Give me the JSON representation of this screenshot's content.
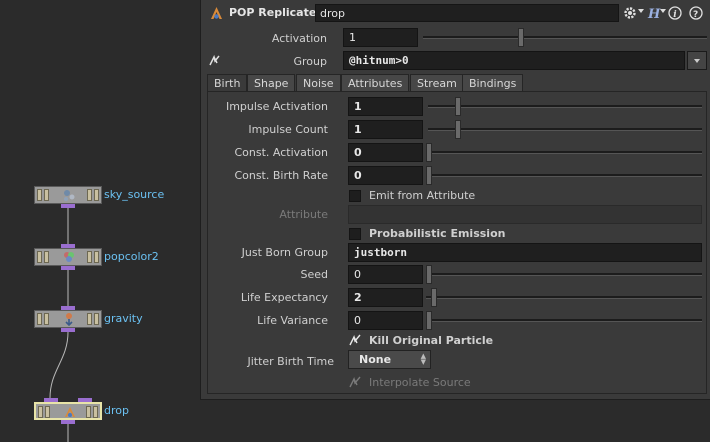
{
  "network": {
    "nodes": [
      {
        "name": "sky_source"
      },
      {
        "name": "popcolor2"
      },
      {
        "name": "gravity"
      },
      {
        "name": "drop"
      }
    ]
  },
  "pane": {
    "node_type": "POP Replicate",
    "node_name": "drop",
    "activation": {
      "label": "Activation",
      "value": "1",
      "slider": 0.34
    },
    "group": {
      "label": "Group",
      "value": "@hitnum>0"
    },
    "tabs": [
      "Birth",
      "Shape",
      "Noise",
      "Attributes",
      "Stream",
      "Bindings"
    ],
    "active_tab": "Birth",
    "birth": {
      "impulse_activation": {
        "label": "Impulse Activation",
        "value": "1",
        "slider": 0.1
      },
      "impulse_count": {
        "label": "Impulse Count",
        "value": "1",
        "slider": 0.1
      },
      "const_activation": {
        "label": "Const. Activation",
        "value": "0",
        "slider": 0.0
      },
      "const_birth_rate": {
        "label": "Const. Birth Rate",
        "value": "0",
        "slider": 0.0
      },
      "emit_from_attribute": {
        "label": "Emit from Attribute",
        "checked": false
      },
      "attribute": {
        "label": "Attribute",
        "value": ""
      },
      "probabilistic_emission": {
        "label": "Probabilistic Emission",
        "checked": false
      },
      "just_born_group": {
        "label": "Just Born Group",
        "value": "justborn"
      },
      "seed": {
        "label": "Seed",
        "value": "0",
        "slider": 0.0
      },
      "life_expectancy": {
        "label": "Life Expectancy",
        "value": "2",
        "slider": 0.02
      },
      "life_variance": {
        "label": "Life Variance",
        "value": "0",
        "slider": 0.0
      },
      "kill_original_particle": {
        "label": "Kill Original Particle",
        "checked": true
      },
      "jitter_birth_time": {
        "label": "Jitter Birth Time",
        "value": "None"
      },
      "interpolate_source": {
        "label": "Interpolate Source",
        "checked": true
      }
    }
  },
  "colors": {
    "node_label": "#6bc1f2",
    "connector": "#9a6ed0",
    "pane_bg": "#3a3a3a",
    "network_bg": "#2b2b2b"
  },
  "icons": {
    "node_type": "pop-replicate-icon",
    "gear": "gear-icon",
    "help_h": "houdini-help-icon",
    "info": "info-icon",
    "help": "help-icon"
  }
}
